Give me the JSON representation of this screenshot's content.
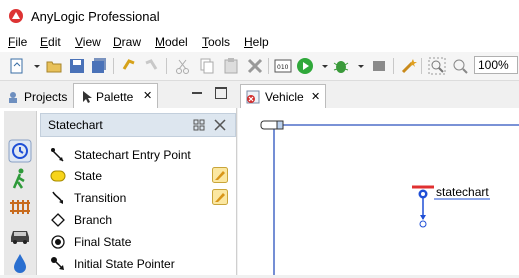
{
  "window": {
    "title": "AnyLogic Professional",
    "icon": "anylogic-logo-icon"
  },
  "menu": [
    "File",
    "Edit",
    "View",
    "Draw",
    "Model",
    "Tools",
    "Help"
  ],
  "menu_mnemonics": [
    "F",
    "E",
    "V",
    "D",
    "M",
    "T",
    "H"
  ],
  "toolbar": {
    "icons": [
      "new-model-icon",
      "dropdown-arrow-icon",
      "open-icon",
      "save-icon",
      "save-all-icon",
      "undo-icon",
      "redo-icon",
      "cut-icon",
      "copy-icon",
      "paste-icon",
      "delete-icon",
      "build-icon",
      "run-icon",
      "run-dropdown-icon",
      "debug-icon",
      "debug-dropdown-icon",
      "stop-icon",
      "wand-icon",
      "zoom-icon",
      "zoom-out-icon"
    ],
    "zoom": "100%"
  },
  "left_panel": {
    "tabs": [
      {
        "label": "Projects"
      },
      {
        "label": "Palette",
        "active": true
      }
    ],
    "close_symbol": "✕",
    "section_title": "Statechart",
    "categories": [
      "statechart-category-icon",
      "pedestrian-category-icon",
      "rail-category-icon",
      "road-traffic-category-icon",
      "fluid-category-icon"
    ],
    "items": [
      {
        "label": "Statechart Entry Point",
        "icon": "entry-point-icon"
      },
      {
        "label": "State",
        "icon": "state-icon",
        "badge": "edit-pencil-icon"
      },
      {
        "label": "Transition",
        "icon": "transition-icon",
        "badge": "edit-pencil-icon"
      },
      {
        "label": "Branch",
        "icon": "branch-icon"
      },
      {
        "label": "Final State",
        "icon": "final-state-icon"
      },
      {
        "label": "Initial State Pointer",
        "icon": "initial-pointer-icon"
      }
    ]
  },
  "editor": {
    "tab_label": "Vehicle",
    "close_symbol": "✕",
    "statechart_label": "statechart",
    "colors": {
      "axis": "#2a52be",
      "entry_bar": "#e03030",
      "entry_node": "#1f4fd6"
    }
  }
}
